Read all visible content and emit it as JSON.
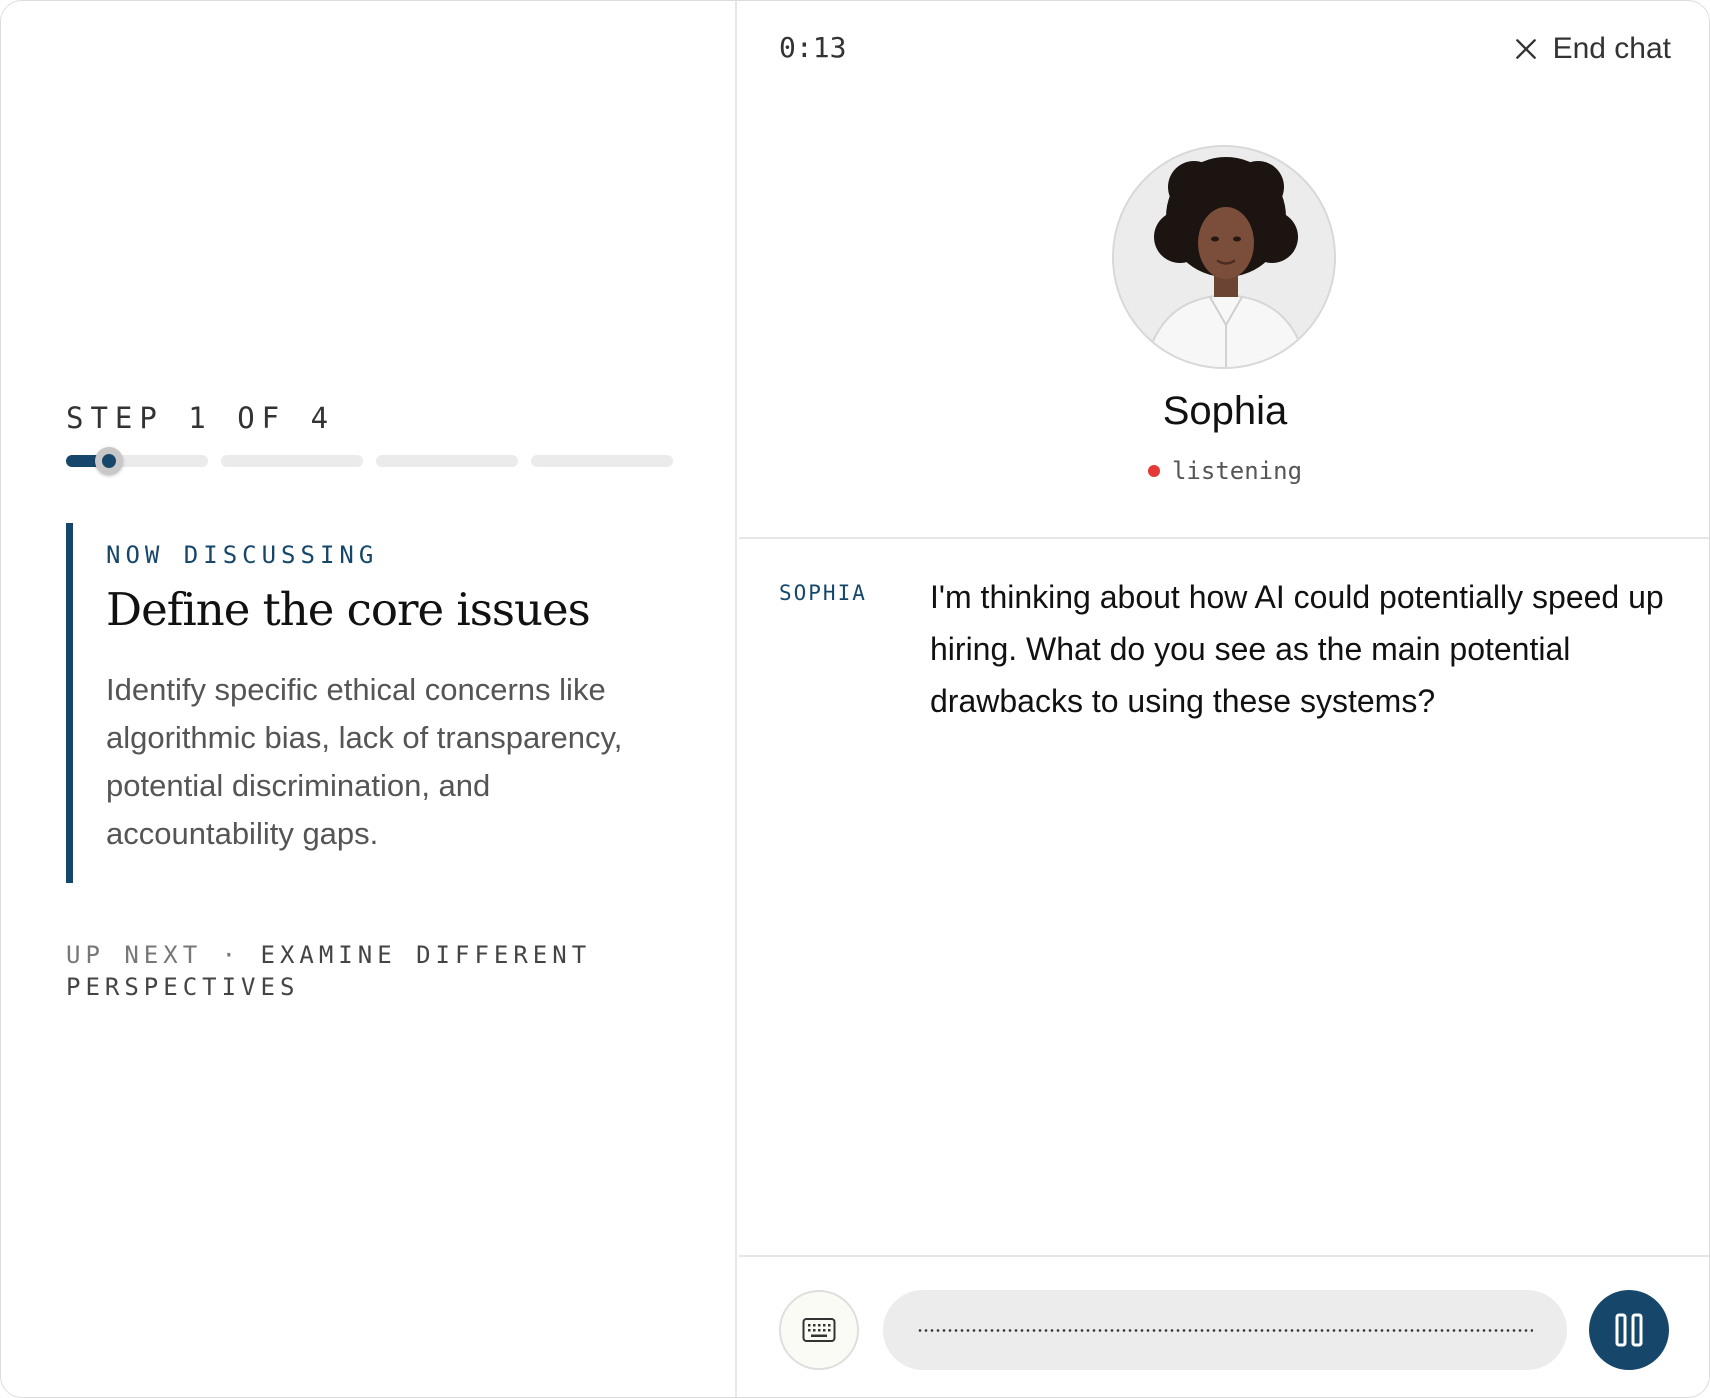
{
  "left_panel": {
    "step_label": "STEP 1 OF 4",
    "progress": {
      "total_steps": 4,
      "current_step": 1,
      "current_fraction": 0.3
    },
    "now_discussing_label": "NOW DISCUSSING",
    "step_title": "Define the core issues",
    "step_description": "Identify specific ethical concerns like algorithmic bias, lack of transparency, potential discrimination, and accountability gaps.",
    "up_next_prefix": "UP NEXT ·",
    "up_next_title": "EXAMINE DIFFERENT PERSPECTIVES"
  },
  "chat": {
    "timer": "0:13",
    "end_chat_label": "End chat",
    "agent_name": "Sophia",
    "status_text": "listening",
    "status_color": "#e53935",
    "messages": [
      {
        "speaker": "SOPHIA",
        "text": "I'm thinking about how AI could potentially speed up hiring. What do you see as the main potential drawbacks to using these systems?"
      }
    ]
  },
  "controls": {
    "keyboard_icon": "keyboard-icon",
    "pause_icon": "pause-icon"
  },
  "colors": {
    "accent": "#16476b",
    "track": "#ebebeb"
  }
}
